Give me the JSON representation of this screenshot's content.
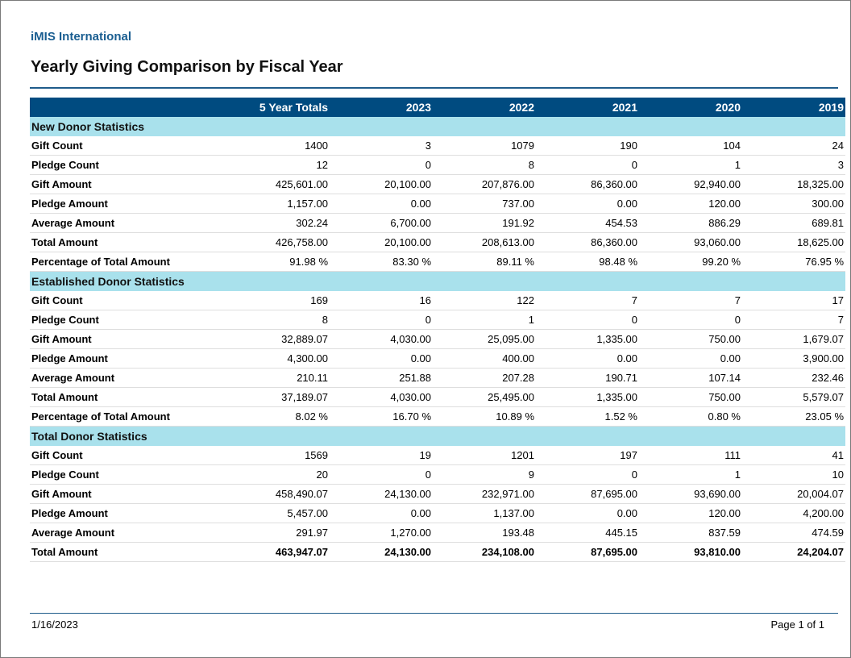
{
  "header": {
    "organization": "iMIS International",
    "title": "Yearly Giving Comparison by Fiscal Year"
  },
  "table": {
    "columns": [
      "",
      "5 Year Totals",
      "2023",
      "2022",
      "2021",
      "2020",
      "2019"
    ],
    "sections": [
      {
        "title": "New Donor Statistics",
        "rows": [
          {
            "label": "Gift Count",
            "values": [
              "1400",
              "3",
              "1079",
              "190",
              "104",
              "24"
            ]
          },
          {
            "label": "Pledge Count",
            "values": [
              "12",
              "0",
              "8",
              "0",
              "1",
              "3"
            ]
          },
          {
            "label": "Gift Amount",
            "values": [
              "425,601.00",
              "20,100.00",
              "207,876.00",
              "86,360.00",
              "92,940.00",
              "18,325.00"
            ]
          },
          {
            "label": "Pledge Amount",
            "values": [
              "1,157.00",
              "0.00",
              "737.00",
              "0.00",
              "120.00",
              "300.00"
            ]
          },
          {
            "label": "Average Amount",
            "values": [
              "302.24",
              "6,700.00",
              "191.92",
              "454.53",
              "886.29",
              "689.81"
            ]
          },
          {
            "label": "Total Amount",
            "values": [
              "426,758.00",
              "20,100.00",
              "208,613.00",
              "86,360.00",
              "93,060.00",
              "18,625.00"
            ]
          },
          {
            "label": "Percentage of Total Amount",
            "values": [
              "91.98 %",
              "83.30 %",
              "89.11 %",
              "98.48 %",
              "99.20 %",
              "76.95 %"
            ]
          }
        ]
      },
      {
        "title": "Established Donor Statistics",
        "rows": [
          {
            "label": "Gift Count",
            "values": [
              "169",
              "16",
              "122",
              "7",
              "7",
              "17"
            ]
          },
          {
            "label": "Pledge Count",
            "values": [
              "8",
              "0",
              "1",
              "0",
              "0",
              "7"
            ]
          },
          {
            "label": "Gift Amount",
            "values": [
              "32,889.07",
              "4,030.00",
              "25,095.00",
              "1,335.00",
              "750.00",
              "1,679.07"
            ]
          },
          {
            "label": "Pledge Amount",
            "values": [
              "4,300.00",
              "0.00",
              "400.00",
              "0.00",
              "0.00",
              "3,900.00"
            ]
          },
          {
            "label": "Average Amount",
            "values": [
              "210.11",
              "251.88",
              "207.28",
              "190.71",
              "107.14",
              "232.46"
            ]
          },
          {
            "label": "Total Amount",
            "values": [
              "37,189.07",
              "4,030.00",
              "25,495.00",
              "1,335.00",
              "750.00",
              "5,579.07"
            ]
          },
          {
            "label": "Percentage of Total Amount",
            "values": [
              "8.02 %",
              "16.70 %",
              "10.89 %",
              "1.52 %",
              "0.80 %",
              "23.05 %"
            ]
          }
        ]
      },
      {
        "title": "Total Donor Statistics",
        "rows": [
          {
            "label": "Gift Count",
            "values": [
              "1569",
              "19",
              "1201",
              "197",
              "111",
              "41"
            ]
          },
          {
            "label": "Pledge Count",
            "values": [
              "20",
              "0",
              "9",
              "0",
              "1",
              "10"
            ]
          },
          {
            "label": "Gift Amount",
            "values": [
              "458,490.07",
              "24,130.00",
              "232,971.00",
              "87,695.00",
              "93,690.00",
              "20,004.07"
            ]
          },
          {
            "label": "Pledge Amount",
            "values": [
              "5,457.00",
              "0.00",
              "1,137.00",
              "0.00",
              "120.00",
              "4,200.00"
            ]
          },
          {
            "label": "Average Amount",
            "values": [
              "291.97",
              "1,270.00",
              "193.48",
              "445.15",
              "837.59",
              "474.59"
            ]
          },
          {
            "label": "Total Amount",
            "values": [
              "463,947.07",
              "24,130.00",
              "234,108.00",
              "87,695.00",
              "93,810.00",
              "24,204.07"
            ],
            "bold": true
          }
        ]
      }
    ]
  },
  "footer": {
    "date": "1/16/2023",
    "page": "Page 1 of  1"
  },
  "colors": {
    "header_bg": "#004b80",
    "section_bg": "#a9e1ec",
    "org_text": "#1a5e91",
    "rule": "#1f5c8b"
  }
}
